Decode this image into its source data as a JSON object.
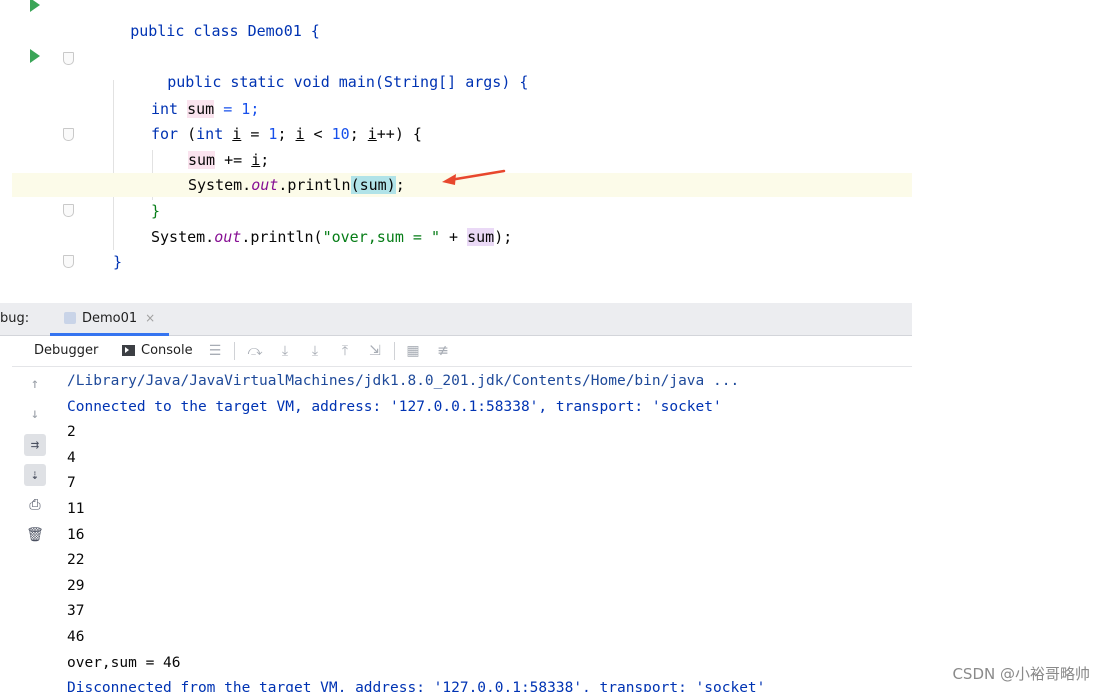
{
  "editor": {
    "lines": {
      "class_decl": "public class Demo01 {",
      "main_decl": "public static void main(String[] args) {",
      "int_kw": "int",
      "sum_var": "sum",
      "assign_one": " = 1;",
      "for_kw": "for",
      "for_paren_open": " (",
      "for_int": "int",
      "for_i1": "i",
      "for_eq": " = ",
      "for_one": "1",
      "for_semicolon1": "; ",
      "for_i2": "i",
      "for_lt": " < ",
      "for_ten": "10",
      "for_semicolon2": "; ",
      "for_i3": "i",
      "for_close": "++) {",
      "sum_plus_prefix": "sum",
      "sum_plus_suffix": " += ",
      "sum_plus_i": "i",
      "sum_plus_end": ";",
      "println_prefix": "System.",
      "println_out": "out",
      "println_method": ".println",
      "println_arg": "(sum)",
      "println_end": ";",
      "close_for": "}",
      "println2_prefix": "System.",
      "println2_out": "out",
      "println2_method": ".println(",
      "println2_str": "\"over,sum = \"",
      "println2_plus": " + ",
      "println2_sum": "sum",
      "println2_end": ");",
      "close_main": "}"
    }
  },
  "debug": {
    "label": "bug:",
    "tab_label": "Demo01",
    "close_glyph": "×",
    "debugger_tab": "Debugger",
    "console_tab": "Console"
  },
  "console": {
    "lines": [
      {
        "kind": "cmd",
        "text": "/Library/Java/JavaVirtualMachines/jdk1.8.0_201.jdk/Contents/Home/bin/java ..."
      },
      {
        "kind": "sys",
        "text": "Connected to the target VM, address: '127.0.0.1:58338', transport: 'socket'"
      },
      {
        "kind": "std",
        "text": "2"
      },
      {
        "kind": "std",
        "text": "4"
      },
      {
        "kind": "std",
        "text": "7"
      },
      {
        "kind": "std",
        "text": "11"
      },
      {
        "kind": "std",
        "text": "16"
      },
      {
        "kind": "std",
        "text": "22"
      },
      {
        "kind": "std",
        "text": "29"
      },
      {
        "kind": "std",
        "text": "37"
      },
      {
        "kind": "std",
        "text": "46"
      },
      {
        "kind": "std",
        "text": "over,sum = 46"
      },
      {
        "kind": "sys",
        "text": "Disconnected from the target VM, address: '127.0.0.1:58338', transport: 'socket'"
      }
    ]
  },
  "watermark": "CSDN @小裕哥略帅",
  "icons": {
    "run": "run-icon",
    "up": "up-arrow-icon",
    "down": "down-arrow-icon",
    "wrap": "soft-wrap-icon",
    "scroll_end": "scroll-to-end-icon",
    "print": "print-icon",
    "trash": "clear-icon"
  },
  "colors": {
    "keyword": "#0033b3",
    "number": "#1750eb",
    "string": "#067d17",
    "field": "#871094",
    "run_green": "#3aa557",
    "arrow_red": "#e8472d",
    "tab_accent": "#3574f0"
  }
}
